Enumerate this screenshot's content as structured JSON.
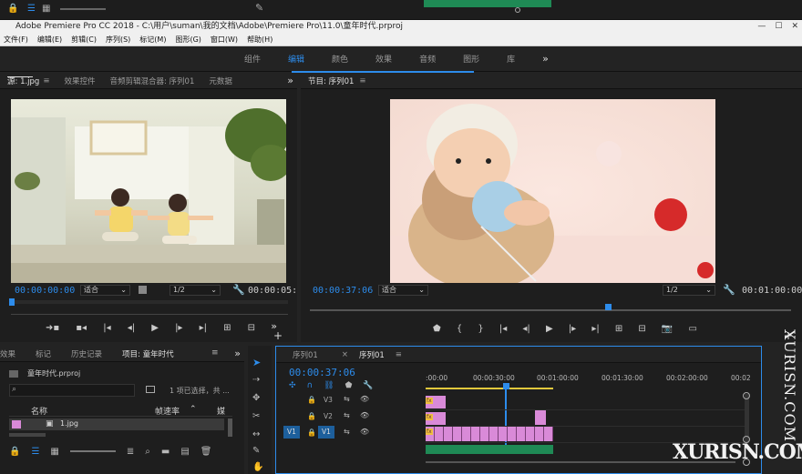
{
  "app": {
    "title": "Adobe Premiere Pro CC 2018 - C:\\用户\\suman\\我的文档\\Adobe\\Premiere Pro\\11.0\\童年时代.prproj",
    "logo_text": "Pr",
    "window_buttons": [
      "—",
      "☐",
      "✕"
    ]
  },
  "menu": [
    "文件(F)",
    "编辑(E)",
    "剪辑(C)",
    "序列(S)",
    "标记(M)",
    "图形(G)",
    "窗口(W)",
    "帮助(H)"
  ],
  "workspaces": {
    "items": [
      "组件",
      "编辑",
      "颜色",
      "效果",
      "音频",
      "图形",
      "库"
    ],
    "active_index": 1,
    "more": "»"
  },
  "source_panel": {
    "tabs": [
      "源: 1.jpg",
      "效果控件",
      "音频剪辑混合器: 序列01",
      "元数据"
    ],
    "timecode": "00:00:00:00",
    "fit": "适合",
    "quality": "1/2",
    "duration": "00:00:05:"
  },
  "program_panel": {
    "tab": "节目: 序列01",
    "timecode": "00:00:37:06",
    "fit": "适合",
    "quality": "1/2",
    "duration": "00:01:00:00",
    "playhead_fraction": 0.62
  },
  "project_panel": {
    "tabs": [
      "效果",
      "标记",
      "历史记录",
      "项目: 童年时代"
    ],
    "project_file": "童年时代.prproj",
    "selection_info": "1 项已选择，共 ...",
    "columns": [
      "名称",
      "帧速率",
      "媒"
    ],
    "item": "1.jpg"
  },
  "timeline": {
    "tabs": [
      "序列01",
      "序列01"
    ],
    "timecode": "00:00:37:06",
    "ruler_labels": [
      ":00:00",
      "00:00:30:00",
      "00:01:00:00",
      "00:01:30:00",
      "00:02:00:00",
      "00:02"
    ],
    "tracks": [
      "V3",
      "V2",
      "V1"
    ],
    "source_patch": "V1",
    "playhead_fraction": 0.26
  },
  "watermark": {
    "vertical": "XURISN.COM",
    "horizontal": "XURISN.COM"
  },
  "colors": {
    "accent": "#2d8ceb",
    "clip": "#d98ad8",
    "audio": "#1f8a55"
  }
}
